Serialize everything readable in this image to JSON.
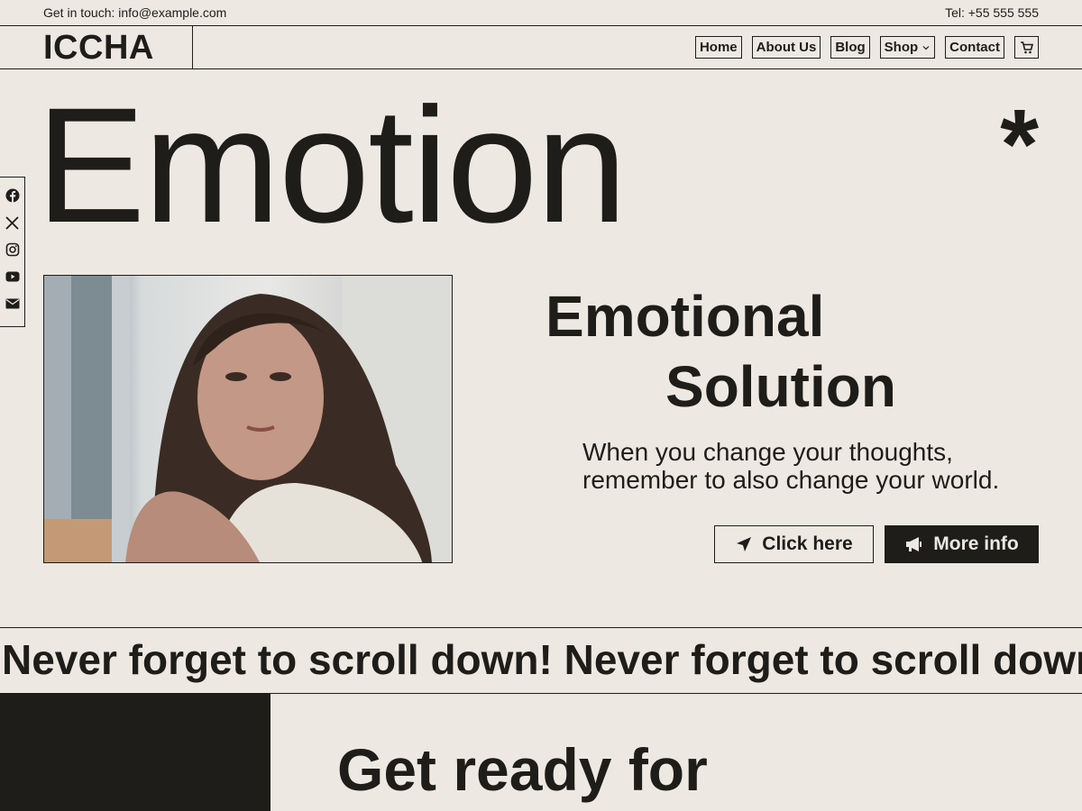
{
  "topbar": {
    "email_text": "Get in touch: info@example.com",
    "phone_text": "Tel: +55 555 555"
  },
  "header": {
    "logo": "ICCHA",
    "nav": [
      {
        "label": "Home"
      },
      {
        "label": "About Us"
      },
      {
        "label": "Blog"
      },
      {
        "label": "Shop",
        "has_dropdown": true
      },
      {
        "label": "Contact"
      }
    ],
    "cart_icon": "cart-icon"
  },
  "hero": {
    "title": "Emotion",
    "asterisk": "*",
    "subtitle_line1": "Emotional",
    "subtitle_line2": "Solution",
    "tagline": "When you change your thoughts, remember to also change your world.",
    "primary_button": "Click here",
    "primary_icon": "location-arrow-icon",
    "secondary_button": "More info",
    "secondary_icon": "megaphone-icon"
  },
  "social": [
    "facebook-icon",
    "x-icon",
    "instagram-icon",
    "youtube-icon",
    "envelope-icon"
  ],
  "marquee": "Never forget to scroll down! Never forget to scroll down",
  "section2": {
    "heading": "Get ready for"
  },
  "colors": {
    "background": "#ede8e2",
    "text": "#1e1d19",
    "dark": "#1e1d19"
  }
}
